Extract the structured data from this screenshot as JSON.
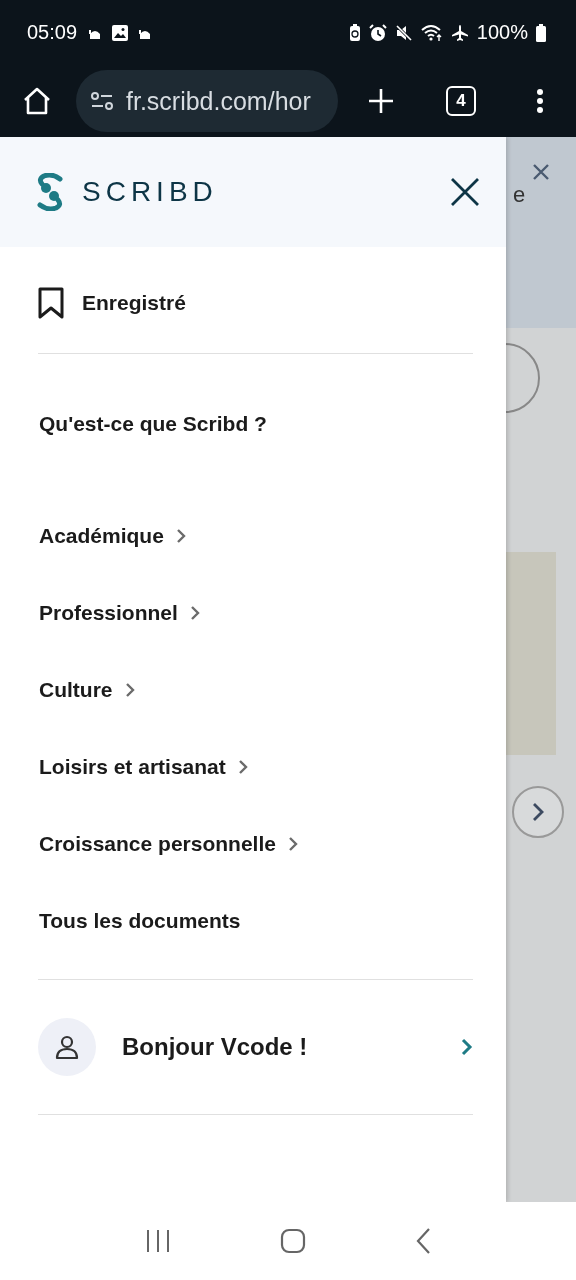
{
  "status_bar": {
    "time": "05:09",
    "battery": "100%"
  },
  "browser": {
    "url": "fr.scribd.com/hor",
    "tab_count": "4"
  },
  "background_page": {
    "text": "e"
  },
  "drawer": {
    "brand": "SCRIBD",
    "saved": "Enregistré",
    "about": "Qu'est-ce que Scribd ?",
    "categories": [
      {
        "label": "Académique",
        "kind": "submenu"
      },
      {
        "label": "Professionnel",
        "kind": "submenu"
      },
      {
        "label": "Culture",
        "kind": "submenu"
      },
      {
        "label": "Loisirs et artisanat",
        "kind": "submenu"
      },
      {
        "label": "Croissance personnelle",
        "kind": "submenu"
      },
      {
        "label": "Tous les documents",
        "kind": "link"
      }
    ],
    "user": {
      "greeting": "Bonjour Vcode !"
    }
  }
}
